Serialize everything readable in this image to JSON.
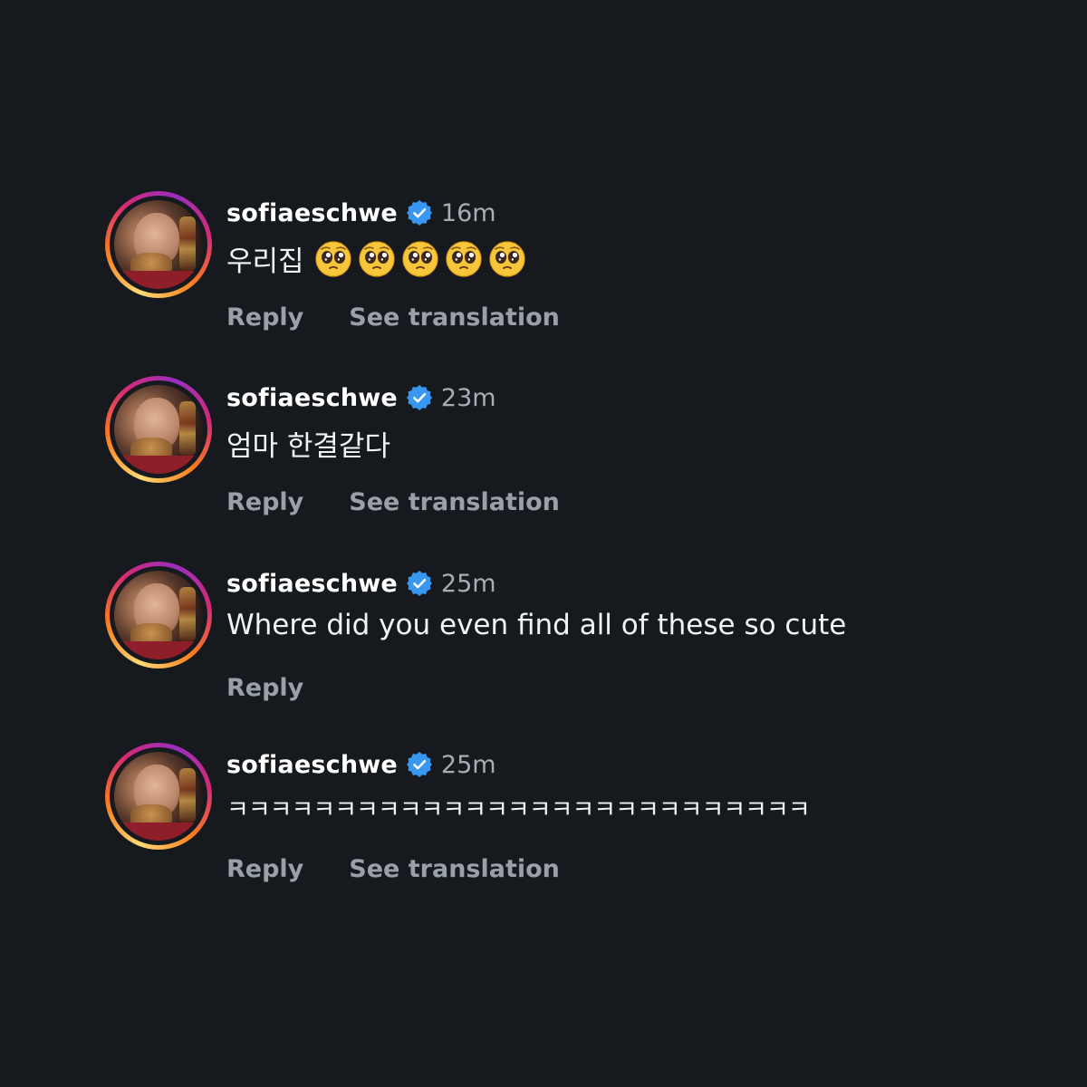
{
  "comments": [
    {
      "username": "sofiaeschwe",
      "time": "16m",
      "text": "우리집",
      "emoji_count": 5,
      "emoji": "pleading-face-icon",
      "reply_label": "Reply",
      "translation_label": "See translation"
    },
    {
      "username": "sofiaeschwe",
      "time": "23m",
      "text": "엄마 한결같다",
      "reply_label": "Reply",
      "translation_label": "See translation"
    },
    {
      "username": "sofiaeschwe",
      "time": "25m",
      "text": "Where did you even find all of these so cute",
      "reply_label": "Reply"
    },
    {
      "username": "sofiaeschwe",
      "time": "25m",
      "text": "ㅋㅋㅋㅋㅋㅋㅋㅋㅋㅋㅋㅋㅋㅋㅋㅋㅋㅋㅋㅋㅋㅋㅋㅋㅋㅋㅋ",
      "reply_label": "Reply",
      "translation_label": "See translation"
    }
  ],
  "colors": {
    "background": "#16191d",
    "verified_badge": "#3897f0",
    "secondary_text": "#a8adb4"
  }
}
